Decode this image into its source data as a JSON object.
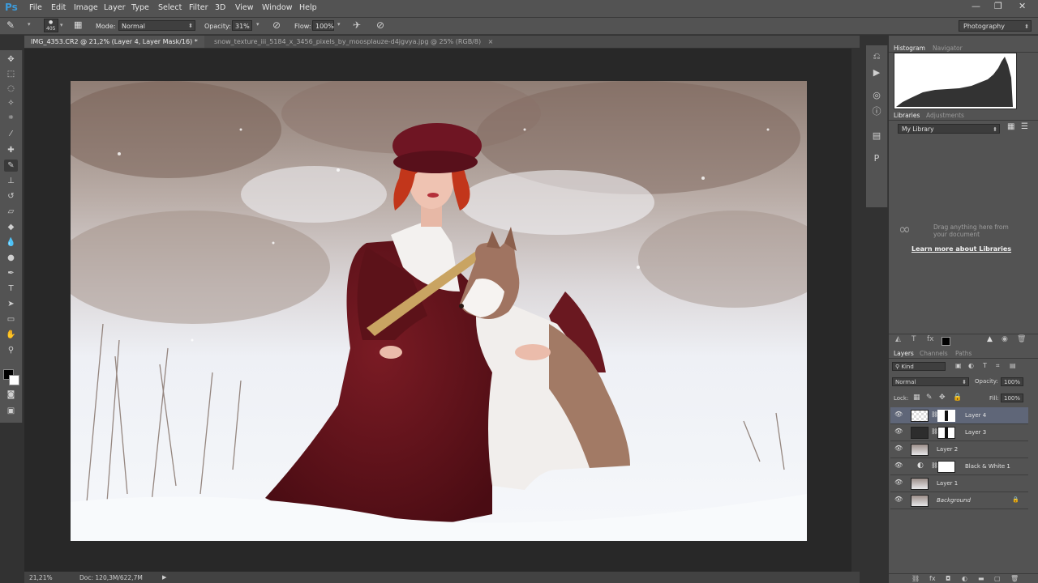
{
  "app": {
    "logo": "Ps",
    "workspace": "Photography"
  },
  "menu": [
    "File",
    "Edit",
    "Image",
    "Layer",
    "Type",
    "Select",
    "Filter",
    "3D",
    "View",
    "Window",
    "Help"
  ],
  "window_controls": {
    "minimize": "—",
    "restore": "❐",
    "close": "✕"
  },
  "options": {
    "brush_size": "405",
    "mode_label": "Mode:",
    "mode_value": "Normal",
    "opacity_label": "Opacity:",
    "opacity_value": "31%",
    "flow_label": "Flow:",
    "flow_value": "100%"
  },
  "tabs": [
    {
      "label": "IMG_4353.CR2 @ 21,2% (Layer 4, Layer Mask/16) *",
      "close": "×"
    },
    {
      "label": "snow_texture_iii_5184_x_3456_pixels_by_moosplauze-d4jgvya.jpg @ 25% (RGB/8)",
      "close": "×"
    }
  ],
  "status": {
    "zoom": "21,21%",
    "doc": "Doc: 120,3M/622,7M",
    "arrow": "▶"
  },
  "panels": {
    "histogram_tab": "Histogram",
    "navigator_tab": "Navigator",
    "libraries_tab": "Libraries",
    "adjustments_tab": "Adjustments",
    "library_select": "My Library",
    "libraries_hint": "Drag anything here from your document",
    "libraries_link": "Learn more about Libraries",
    "layers_tab": "Layers",
    "channels_tab": "Channels",
    "paths_tab": "Paths",
    "kind_filter": "Kind",
    "blend_mode": "Normal",
    "opacity_label": "Opacity:",
    "opacity_value": "100%",
    "lock_label": "Lock:",
    "fill_label": "Fill:",
    "fill_value": "100%"
  },
  "layers": [
    {
      "name": "Layer 4"
    },
    {
      "name": "Layer 3"
    },
    {
      "name": "Layer 2"
    },
    {
      "name": "Black & White 1"
    },
    {
      "name": "Layer 1"
    },
    {
      "name": "Background"
    }
  ],
  "icons": [
    "brush-tool-icon",
    "move-tool-icon",
    "marquee-tool-icon",
    "lasso-tool-icon",
    "magic-wand-icon",
    "crop-icon",
    "eyedropper-icon",
    "healing-brush-icon",
    "brush-icon",
    "clone-stamp-icon",
    "history-brush-icon",
    "eraser-icon",
    "paint-bucket-icon",
    "blur-icon",
    "dodge-icon",
    "pen-icon",
    "type-icon",
    "path-select-icon",
    "rectangle-icon",
    "hand-icon",
    "zoom-icon",
    "eye-icon",
    "lock-icon",
    "link-icon"
  ],
  "colors": {
    "accent": "#3d9ad9",
    "panel": "#535353",
    "canvas_bg": "#282828",
    "selected_layer": "#5f6678"
  }
}
